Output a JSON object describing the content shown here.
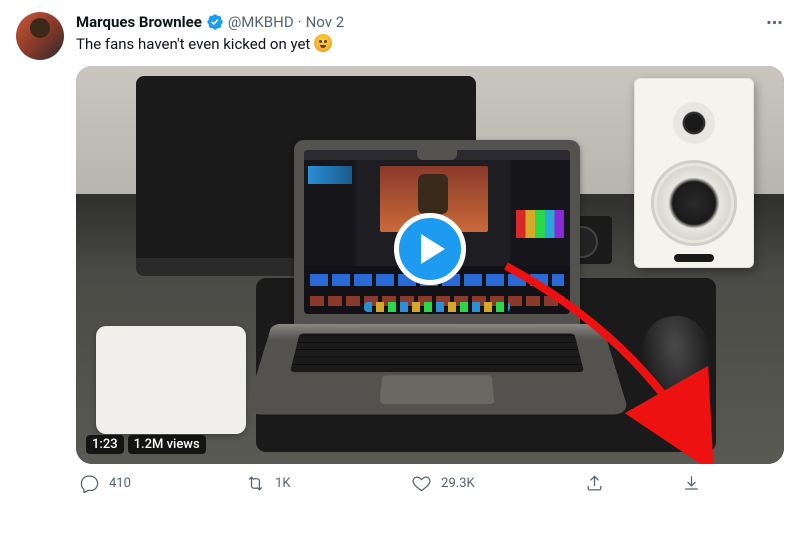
{
  "author": {
    "display_name": "Marques Brownlee",
    "handle": "@MKBHD",
    "verified": true,
    "date": "Nov 2"
  },
  "tweet": {
    "text": "The fans haven't even kicked on yet ",
    "emoji_name": "worried-face"
  },
  "video": {
    "duration": "1:23",
    "views": "1.2M views"
  },
  "stats": {
    "replies": "410",
    "retweets": "1K",
    "likes": "29.3K"
  },
  "colors": {
    "accent": "#1d9bf0",
    "text_secondary": "#536471"
  }
}
